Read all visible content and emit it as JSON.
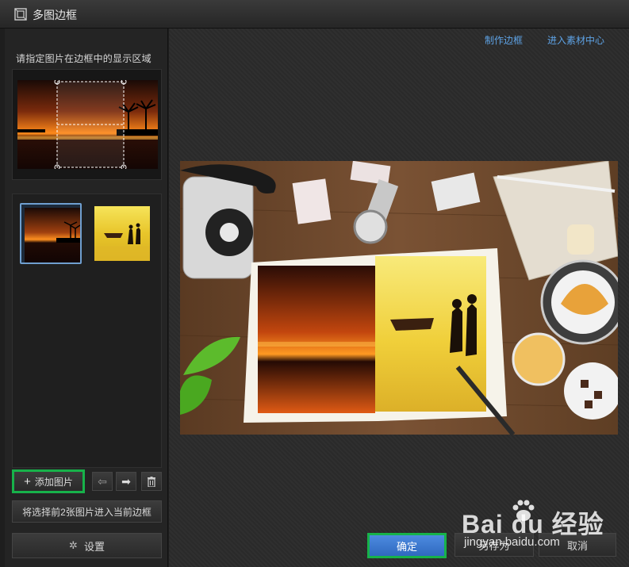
{
  "window": {
    "title": "多图边框"
  },
  "left_panel": {
    "hint": "请指定图片在边框中的显示区域",
    "buttons": {
      "add_image": "添加图片",
      "apply": "将选择前2张图片进入当前边框",
      "settings": "设置"
    }
  },
  "top_links": {
    "make_frame": "制作边框",
    "material_center": "进入素材中心"
  },
  "footer": {
    "confirm": "确定",
    "save_as": "另存为",
    "cancel": "取消"
  },
  "watermark": {
    "brand": "Bai du 经验",
    "url": "jingyan.baidu.com"
  },
  "icons": {
    "window_icon": "frame-icon",
    "plus": "plus-icon",
    "left_arrow": "arrow-left-icon",
    "right_arrow": "arrow-right-icon",
    "delete": "trash-icon",
    "settings": "gear-icon"
  },
  "colors": {
    "accent_blue": "#3b7ad4",
    "link_blue": "#5ea3e6",
    "highlight_green": "#17b24a",
    "selected_border": "#6f9fd0"
  }
}
